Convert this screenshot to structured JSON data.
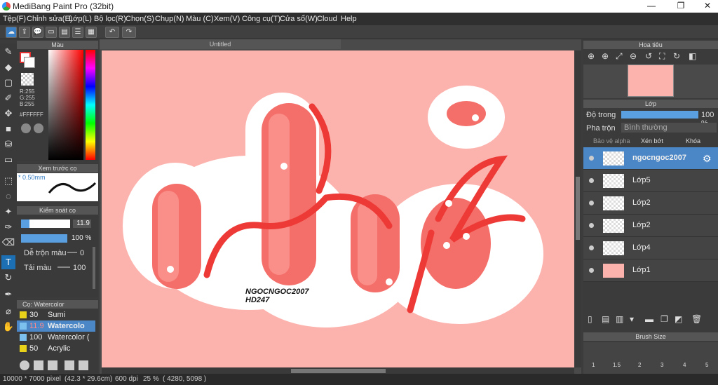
{
  "window": {
    "title": "MediBang Paint Pro (32bit)"
  },
  "menu": [
    "Tệp(F)",
    "Chỉnh sửa(E)",
    "Lớp(L)",
    "Bộ lọc(R)",
    "Chọn(S)",
    "Chụp(N)",
    "Màu (C)",
    "Xem(V)",
    "Công cụ(T)",
    "Cửa sổ(W)",
    "Cloud",
    "Help"
  ],
  "color_panel": {
    "title": "Màu",
    "r": "R:255",
    "g": "G:255",
    "b": "B:255",
    "hex": "#FFFFFF"
  },
  "preview_panel": {
    "title": "Xem trước cọ",
    "size": "* 0.50mm"
  },
  "brush_control": {
    "title": "Kiểm soát cọ",
    "size": "11.9",
    "opacity": "100 %",
    "blend_label": "Dễ trộn màu",
    "blend_value": "0",
    "color_label": "Tải màu",
    "color_value": "100"
  },
  "brush_panel": {
    "title": "Cọ: Watercolor",
    "items": [
      {
        "size": "30",
        "name": "Sumi",
        "color": "#e8d21a"
      },
      {
        "size": "11.9",
        "name": "Watercolo",
        "color": "#7cc0ee"
      },
      {
        "size": "100",
        "name": "Watercolor (",
        "color": "#7cc0ee"
      },
      {
        "size": "50",
        "name": "Acrylic",
        "color": "#e8d21a"
      }
    ]
  },
  "document": {
    "tab": "Untitled",
    "text_line1": "NGOCNGOC2007",
    "text_line2": "HD247"
  },
  "navigator": {
    "title": "Hoa tiêu"
  },
  "layer_panel": {
    "title": "Lớp",
    "opacity_label": "Độ trong",
    "opacity_value": "100 %",
    "blend_label": "Pha trộn",
    "blend_value": "Bình thường",
    "protect_alpha": "Bảo vệ alpha",
    "clipping": "Xén bớt",
    "lock": "Khóa"
  },
  "layers": [
    {
      "name": "ngocngoc2007",
      "selected": true
    },
    {
      "name": "Lớp5"
    },
    {
      "name": "Lớp2"
    },
    {
      "name": "Lớp2"
    },
    {
      "name": "Lớp4"
    },
    {
      "name": "Lớp1"
    }
  ],
  "brush_size_panel": {
    "title": "Brush Size",
    "sizes": [
      "1",
      "1.5",
      "2",
      "3",
      "4",
      "5"
    ]
  },
  "status": {
    "pixel": "10000 * 7000 pixel",
    "cm": "(42.3 * 29.6cm)",
    "dpi": "600 dpi",
    "zoom": "25 %",
    "coords": "( 4280, 5098 )"
  },
  "colors": {
    "accent": "#4b87c6",
    "canvas_bg": "#fdb3ad",
    "letter": "#f56f6a",
    "letter_dark": "#ee3a36"
  }
}
